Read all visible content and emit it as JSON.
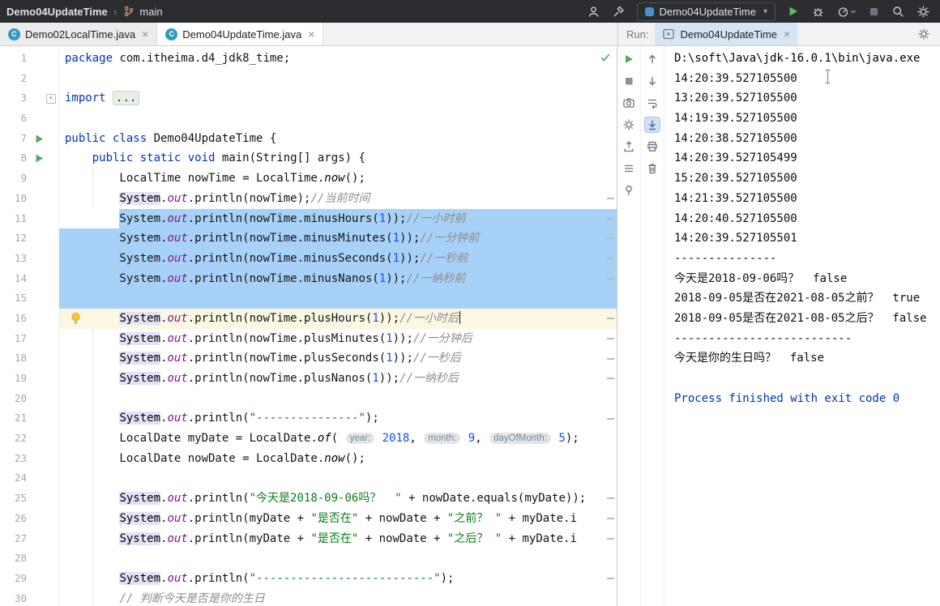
{
  "glyphs": {
    "class_icon": "C",
    "close": "×",
    "chevron": "›",
    "dropdown": "▾",
    "fold_plus": "+"
  },
  "titlebar": {
    "project": "Demo04UpdateTime",
    "branch": "main",
    "run_config": "Demo04UpdateTime"
  },
  "tab_bar": {
    "run_label": "Run:",
    "run_tab": "Demo04UpdateTime",
    "tabs": [
      {
        "label": "Demo02LocalTime.java",
        "active": false
      },
      {
        "label": "Demo04UpdateTime.java",
        "active": true
      }
    ]
  },
  "editor": {
    "lines": [
      {
        "n": "1",
        "seg": [
          [
            "kw",
            "package "
          ],
          [
            "pl",
            "com.itheima.d4_jdk8_time;"
          ]
        ]
      },
      {
        "n": "2",
        "seg": []
      },
      {
        "n": "3",
        "gutter": "fold",
        "seg": [
          [
            "kw",
            "import "
          ],
          [
            "fold",
            "..."
          ]
        ]
      },
      {
        "n": "6",
        "seg": []
      },
      {
        "n": "7",
        "gutter": "play",
        "seg": [
          [
            "kw",
            "public class "
          ],
          [
            "pl",
            "Demo04UpdateTime {"
          ]
        ]
      },
      {
        "n": "8",
        "gutter": "play",
        "seg": [
          [
            "pl",
            "    "
          ],
          [
            "kw",
            "public static void "
          ],
          [
            "pl",
            "main(String[] args) {"
          ]
        ]
      },
      {
        "n": "9",
        "seg": [
          [
            "pl",
            "        LocalTime nowTime = LocalTime."
          ],
          [
            "itl",
            "now"
          ],
          [
            "pl",
            "();"
          ]
        ]
      },
      {
        "n": "10",
        "seg": [
          [
            "pl",
            "        "
          ],
          [
            "sys",
            "System"
          ],
          [
            "pl",
            "."
          ],
          [
            "fld",
            "out"
          ],
          [
            "pl",
            ".println(nowTime);"
          ],
          [
            "cmt",
            "//当前时间"
          ]
        ]
      },
      {
        "n": "11",
        "sel": "text",
        "seg": [
          [
            "pl",
            "        System."
          ],
          [
            "fld",
            "out"
          ],
          [
            "pl",
            ".println(nowTime.minusHours("
          ],
          [
            "num",
            "1"
          ],
          [
            "pl",
            "));"
          ],
          [
            "cmt",
            "//一小时前"
          ]
        ]
      },
      {
        "n": "12",
        "sel": true,
        "seg": [
          [
            "pl",
            "        System."
          ],
          [
            "fld",
            "out"
          ],
          [
            "pl",
            ".println(nowTime.minusMinutes("
          ],
          [
            "num",
            "1"
          ],
          [
            "pl",
            "));"
          ],
          [
            "cmt",
            "//一分钟前"
          ]
        ]
      },
      {
        "n": "13",
        "sel": true,
        "seg": [
          [
            "pl",
            "        System."
          ],
          [
            "fld",
            "out"
          ],
          [
            "pl",
            ".println(nowTime.minusSeconds("
          ],
          [
            "num",
            "1"
          ],
          [
            "pl",
            "));"
          ],
          [
            "cmt",
            "//一秒前"
          ]
        ]
      },
      {
        "n": "14",
        "sel": true,
        "seg": [
          [
            "pl",
            "        System."
          ],
          [
            "fld",
            "out"
          ],
          [
            "pl",
            ".println(nowTime.minusNanos("
          ],
          [
            "num",
            "1"
          ],
          [
            "pl",
            "));"
          ],
          [
            "cmt",
            "//一纳秒前"
          ]
        ]
      },
      {
        "n": "15",
        "sel": true,
        "seg": []
      },
      {
        "n": "16",
        "cur": true,
        "bulb": true,
        "caret": true,
        "seg": [
          [
            "pl",
            "        "
          ],
          [
            "sys",
            "System"
          ],
          [
            "pl",
            "."
          ],
          [
            "fld",
            "out"
          ],
          [
            "pl",
            ".println(nowTime.plusHours("
          ],
          [
            "num",
            "1"
          ],
          [
            "pl",
            "));"
          ],
          [
            "cmt",
            "//一小时后"
          ]
        ]
      },
      {
        "n": "17",
        "seg": [
          [
            "pl",
            "        "
          ],
          [
            "sys",
            "System"
          ],
          [
            "pl",
            "."
          ],
          [
            "fld",
            "out"
          ],
          [
            "pl",
            ".println(nowTime.plusMinutes("
          ],
          [
            "num",
            "1"
          ],
          [
            "pl",
            "));"
          ],
          [
            "cmt",
            "//一分钟后"
          ]
        ]
      },
      {
        "n": "18",
        "seg": [
          [
            "pl",
            "        "
          ],
          [
            "sys",
            "System"
          ],
          [
            "pl",
            "."
          ],
          [
            "fld",
            "out"
          ],
          [
            "pl",
            ".println(nowTime.plusSeconds("
          ],
          [
            "num",
            "1"
          ],
          [
            "pl",
            "));"
          ],
          [
            "cmt",
            "//一秒后"
          ]
        ]
      },
      {
        "n": "19",
        "seg": [
          [
            "pl",
            "        "
          ],
          [
            "sys",
            "System"
          ],
          [
            "pl",
            "."
          ],
          [
            "fld",
            "out"
          ],
          [
            "pl",
            ".println(nowTime.plusNanos("
          ],
          [
            "num",
            "1"
          ],
          [
            "pl",
            "));"
          ],
          [
            "cmt",
            "//一纳秒后"
          ]
        ]
      },
      {
        "n": "20",
        "seg": []
      },
      {
        "n": "21",
        "seg": [
          [
            "pl",
            "        "
          ],
          [
            "sys",
            "System"
          ],
          [
            "pl",
            "."
          ],
          [
            "fld",
            "out"
          ],
          [
            "pl",
            ".println("
          ],
          [
            "str",
            "\"---------------\""
          ],
          [
            "pl",
            ");"
          ]
        ]
      },
      {
        "n": "22",
        "seg": [
          [
            "pl",
            "        LocalDate myDate = LocalDate."
          ],
          [
            "itl",
            "of"
          ],
          [
            "pl",
            "( "
          ],
          [
            "hint",
            "year:"
          ],
          [
            "pl",
            " "
          ],
          [
            "num",
            "2018"
          ],
          [
            "pl",
            ", "
          ],
          [
            "hint",
            "month:"
          ],
          [
            "pl",
            " "
          ],
          [
            "num",
            "9"
          ],
          [
            "pl",
            ", "
          ],
          [
            "hint",
            "dayOfMonth:"
          ],
          [
            "pl",
            " "
          ],
          [
            "num",
            "5"
          ],
          [
            "pl",
            ");"
          ]
        ]
      },
      {
        "n": "23",
        "seg": [
          [
            "pl",
            "        LocalDate nowDate = LocalDate."
          ],
          [
            "itl",
            "now"
          ],
          [
            "pl",
            "();"
          ]
        ]
      },
      {
        "n": "24",
        "seg": []
      },
      {
        "n": "25",
        "seg": [
          [
            "pl",
            "        "
          ],
          [
            "sys",
            "System"
          ],
          [
            "pl",
            "."
          ],
          [
            "fld",
            "out"
          ],
          [
            "pl",
            ".println("
          ],
          [
            "str",
            "\"今天是2018-09-06吗？  \""
          ],
          [
            "pl",
            " + nowDate.equals(myDate));"
          ]
        ]
      },
      {
        "n": "26",
        "seg": [
          [
            "pl",
            "        "
          ],
          [
            "sys",
            "System"
          ],
          [
            "pl",
            "."
          ],
          [
            "fld",
            "out"
          ],
          [
            "pl",
            ".println(myDate + "
          ],
          [
            "str",
            "\"是否在\""
          ],
          [
            "pl",
            " + nowDate + "
          ],
          [
            "str",
            "\"之前？ \""
          ],
          [
            "pl",
            " + myDate.i"
          ]
        ]
      },
      {
        "n": "27",
        "seg": [
          [
            "pl",
            "        "
          ],
          [
            "sys",
            "System"
          ],
          [
            "pl",
            "."
          ],
          [
            "fld",
            "out"
          ],
          [
            "pl",
            ".println(myDate + "
          ],
          [
            "str",
            "\"是否在\""
          ],
          [
            "pl",
            " + nowDate + "
          ],
          [
            "str",
            "\"之后？ \""
          ],
          [
            "pl",
            " + myDate.i"
          ]
        ]
      },
      {
        "n": "28",
        "seg": []
      },
      {
        "n": "29",
        "seg": [
          [
            "pl",
            "        "
          ],
          [
            "sys",
            "System"
          ],
          [
            "pl",
            "."
          ],
          [
            "fld",
            "out"
          ],
          [
            "pl",
            ".println("
          ],
          [
            "str",
            "\"--------------------------\""
          ],
          [
            "pl",
            ");"
          ]
        ]
      },
      {
        "n": "30",
        "seg": [
          [
            "pl",
            "        "
          ],
          [
            "cmt",
            "// 判断今天是否是你的生日"
          ]
        ]
      }
    ]
  },
  "console": {
    "lines": [
      {
        "c": "cmd",
        "t": "D:\\soft\\Java\\jdk-16.0.1\\bin\\java.exe"
      },
      {
        "c": "out",
        "t": "14:20:39.527105500"
      },
      {
        "c": "out",
        "t": "13:20:39.527105500"
      },
      {
        "c": "out",
        "t": "14:19:39.527105500"
      },
      {
        "c": "out",
        "t": "14:20:38.527105500"
      },
      {
        "c": "out",
        "t": "14:20:39.527105499"
      },
      {
        "c": "out",
        "t": "15:20:39.527105500"
      },
      {
        "c": "out",
        "t": "14:21:39.527105500"
      },
      {
        "c": "out",
        "t": "14:20:40.527105500"
      },
      {
        "c": "out",
        "t": "14:20:39.527105501"
      },
      {
        "c": "out",
        "t": "---------------"
      },
      {
        "c": "out",
        "t": "今天是2018-09-06吗？  false"
      },
      {
        "c": "out",
        "t": "2018-09-05是否在2021-08-05之前？  true"
      },
      {
        "c": "out",
        "t": "2018-09-05是否在2021-08-05之后？  false"
      },
      {
        "c": "out",
        "t": "--------------------------"
      },
      {
        "c": "out",
        "t": "今天是你的生日吗？  false"
      },
      {
        "c": "out",
        "t": ""
      },
      {
        "c": "proc",
        "t": "Process finished with exit code 0"
      }
    ]
  }
}
